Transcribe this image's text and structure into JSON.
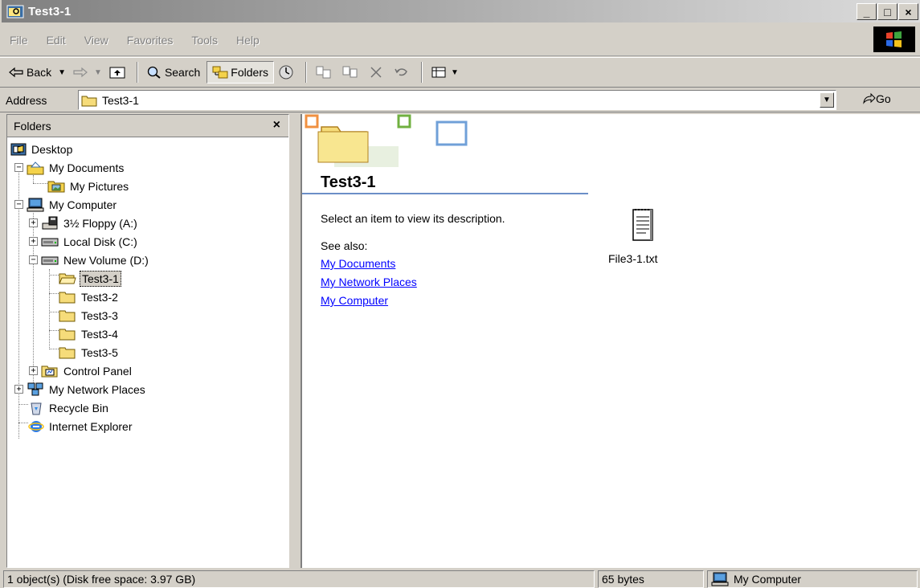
{
  "window": {
    "title": "Test3-1",
    "controls": [
      "_",
      "□",
      "×"
    ]
  },
  "menu": [
    "File",
    "Edit",
    "View",
    "Favorites",
    "Tools",
    "Help"
  ],
  "toolbar": {
    "back_label": "Back",
    "search_label": "Search",
    "folders_label": "Folders"
  },
  "address": {
    "label": "Address",
    "value": "Test3-1",
    "go_label": "Go"
  },
  "folders_pane": {
    "title": "Folders",
    "close": "×"
  },
  "tree": [
    {
      "label": "Desktop"
    },
    {
      "label": "My Documents"
    },
    {
      "label": "My Pictures"
    },
    {
      "label": "My Computer"
    },
    {
      "label": "3½ Floppy (A:)"
    },
    {
      "label": "Local Disk (C:)"
    },
    {
      "label": "New Volume (D:)"
    },
    {
      "label": "Test3-1",
      "selected": true
    },
    {
      "label": "Test3-2"
    },
    {
      "label": "Test3-3"
    },
    {
      "label": "Test3-4"
    },
    {
      "label": "Test3-5"
    },
    {
      "label": "Control Panel"
    },
    {
      "label": "My Network Places"
    },
    {
      "label": "Recycle Bin"
    },
    {
      "label": "Internet Explorer"
    }
  ],
  "content": {
    "folder_title": "Test3-1",
    "description": "Select an item to view its description.",
    "see_also": "See also:",
    "links": [
      "My Documents",
      "My Network Places",
      "My Computer"
    ],
    "files": [
      {
        "name": "File3-1.txt",
        "icon": "text-file-icon"
      }
    ]
  },
  "status": {
    "objects": "1 object(s) (Disk free space: 3.97 GB)",
    "size": "65 bytes",
    "location": "My Computer"
  },
  "colors": {
    "link": "#0000ff",
    "chrome": "#d4d0c8",
    "divider": "#6b8fc7"
  }
}
